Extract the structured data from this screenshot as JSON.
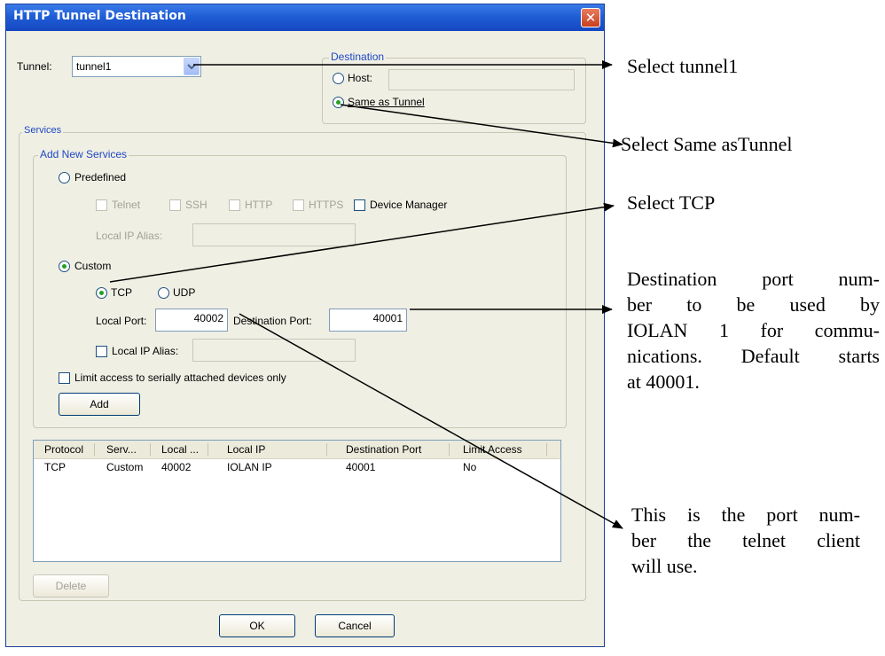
{
  "dialog": {
    "title": "HTTP Tunnel Destination",
    "close_symbol": "✕",
    "tunnel_label": "Tunnel:",
    "tunnel_value": "tunnel1",
    "destination": {
      "legend": "Destination",
      "host_label": "Host:",
      "host_value": "",
      "same_as_tunnel_label": "Same as Tunnel",
      "selected": "same_as_tunnel"
    },
    "services": {
      "legend": "Services",
      "add_new_legend": "Add New Services",
      "predefined_label": "Predefined",
      "telnet_label": "Telnet",
      "ssh_label": "SSH",
      "http_label": "HTTP",
      "https_label": "HTTPS",
      "device_manager_label": "Device Manager",
      "local_ip_alias_label_predef": "Local IP Alias:",
      "custom_label": "Custom",
      "tcp_label": "TCP",
      "udp_label": "UDP",
      "local_port_label": "Local Port:",
      "local_port_value": "40002",
      "destination_port_label": "Destination Port:",
      "destination_port_value": "40001",
      "local_ip_alias_label_custom": "Local IP Alias:",
      "limit_access_label": "Limit access to serially attached devices only",
      "add_button": "Add"
    },
    "table": {
      "columns": [
        "Protocol",
        "Serv...",
        "Local ...",
        "Local IP",
        "Destination Port",
        "Limit Access"
      ],
      "rows": [
        [
          "TCP",
          "Custom",
          "40002",
          "IOLAN IP",
          "40001",
          "No"
        ]
      ]
    },
    "delete_button": "Delete",
    "ok_button": "OK",
    "cancel_button": "Cancel"
  },
  "annotations": {
    "select_tunnel": "Select tunnel1",
    "select_same_as_tunnel": "Select Same asTunnel",
    "select_tcp": "Select TCP",
    "destination_port_line1": "Destination port num-",
    "destination_port_line2": "ber to be used by",
    "destination_port_line3": "IOLAN 1 for commu-",
    "destination_port_line4": "nications. Default starts",
    "destination_port_line5": "at 40001.",
    "local_port_line1": "This is the port num-",
    "local_port_line2": "ber the telnet client",
    "local_port_line3": "will use."
  }
}
